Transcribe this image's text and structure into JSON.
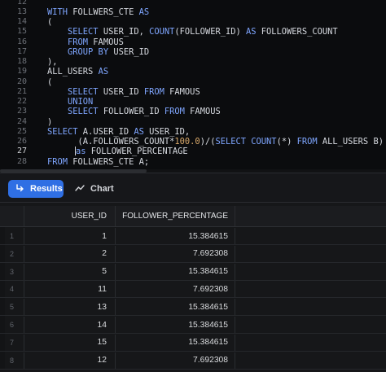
{
  "editor": {
    "lines": [
      {
        "n": "12",
        "segs": []
      },
      {
        "n": "13",
        "segs": [
          {
            "c": "kw",
            "t": "WITH"
          },
          {
            "c": "",
            "t": " FOLLWERS_CTE "
          },
          {
            "c": "kw",
            "t": "AS"
          }
        ]
      },
      {
        "n": "14",
        "segs": [
          {
            "c": "",
            "t": "("
          }
        ]
      },
      {
        "n": "15",
        "segs": [
          {
            "c": "kw",
            "t": "    SELECT"
          },
          {
            "c": "",
            "t": " USER_ID, "
          },
          {
            "c": "kw",
            "t": "COUNT"
          },
          {
            "c": "",
            "t": "(FOLLOWER_ID) "
          },
          {
            "c": "kw",
            "t": "AS"
          },
          {
            "c": "",
            "t": " FOLLOWERS_COUNT"
          }
        ]
      },
      {
        "n": "16",
        "segs": [
          {
            "c": "kw",
            "t": "    FROM"
          },
          {
            "c": "",
            "t": " FAMOUS"
          }
        ]
      },
      {
        "n": "17",
        "segs": [
          {
            "c": "kw",
            "t": "    GROUP BY"
          },
          {
            "c": "",
            "t": " USER_ID"
          }
        ]
      },
      {
        "n": "18",
        "segs": [
          {
            "c": "",
            "t": "),"
          }
        ]
      },
      {
        "n": "19",
        "segs": [
          {
            "c": "",
            "t": "ALL_USERS "
          },
          {
            "c": "kw",
            "t": "AS"
          }
        ]
      },
      {
        "n": "20",
        "segs": [
          {
            "c": "",
            "t": "("
          }
        ]
      },
      {
        "n": "21",
        "segs": [
          {
            "c": "kw",
            "t": "    SELECT"
          },
          {
            "c": "",
            "t": " USER_ID "
          },
          {
            "c": "kw",
            "t": "FROM"
          },
          {
            "c": "",
            "t": " FAMOUS"
          }
        ]
      },
      {
        "n": "22",
        "segs": [
          {
            "c": "kw",
            "t": "    UNION"
          }
        ]
      },
      {
        "n": "23",
        "segs": [
          {
            "c": "kw",
            "t": "    SELECT"
          },
          {
            "c": "",
            "t": " FOLLOWER_ID "
          },
          {
            "c": "kw",
            "t": "FROM"
          },
          {
            "c": "",
            "t": " FAMOUS"
          }
        ]
      },
      {
        "n": "24",
        "segs": [
          {
            "c": "",
            "t": ")"
          }
        ]
      },
      {
        "n": "25",
        "segs": [
          {
            "c": "kw",
            "t": "SELECT"
          },
          {
            "c": "",
            "t": " A.USER_ID "
          },
          {
            "c": "kw",
            "t": "AS"
          },
          {
            "c": "",
            "t": " USER_ID,"
          }
        ]
      },
      {
        "n": "26",
        "segs": [
          {
            "c": "",
            "t": "      (A.FOLLOWERS_COUNT*"
          },
          {
            "c": "num",
            "t": "100.0"
          },
          {
            "c": "",
            "t": ")/("
          },
          {
            "c": "kw",
            "t": "SELECT"
          },
          {
            "c": "",
            "t": " "
          },
          {
            "c": "kw",
            "t": "COUNT"
          },
          {
            "c": "",
            "t": "(*) "
          },
          {
            "c": "kw",
            "t": "FROM"
          },
          {
            "c": "",
            "t": " ALL_USERS B)"
          }
        ]
      },
      {
        "n": "27",
        "active": true,
        "cursor": true,
        "segs": [
          {
            "c": "kw",
            "t": "as"
          },
          {
            "c": "",
            "t": " FOLLOWER_PERCENTAGE"
          }
        ]
      },
      {
        "n": "28",
        "segs": [
          {
            "c": "kw",
            "t": "FROM"
          },
          {
            "c": "",
            "t": " FOLLWERS_CTE A;"
          }
        ]
      }
    ]
  },
  "tabs": {
    "results_label": "Results",
    "chart_label": "Chart",
    "results_icon": "return-arrow-icon",
    "chart_icon": "line-chart-icon",
    "active_color": "#2f6fe4"
  },
  "grid": {
    "columns": [
      "USER_ID",
      "FOLLOWER_PERCENTAGE"
    ],
    "rows": [
      {
        "idx": "1",
        "user_id": "1",
        "pct": "15.384615"
      },
      {
        "idx": "2",
        "user_id": "2",
        "pct": "7.692308"
      },
      {
        "idx": "3",
        "user_id": "5",
        "pct": "15.384615"
      },
      {
        "idx": "4",
        "user_id": "11",
        "pct": "7.692308"
      },
      {
        "idx": "5",
        "user_id": "13",
        "pct": "15.384615"
      },
      {
        "idx": "6",
        "user_id": "14",
        "pct": "15.384615"
      },
      {
        "idx": "7",
        "user_id": "15",
        "pct": "15.384615"
      },
      {
        "idx": "8",
        "user_id": "12",
        "pct": "7.692308"
      }
    ]
  }
}
